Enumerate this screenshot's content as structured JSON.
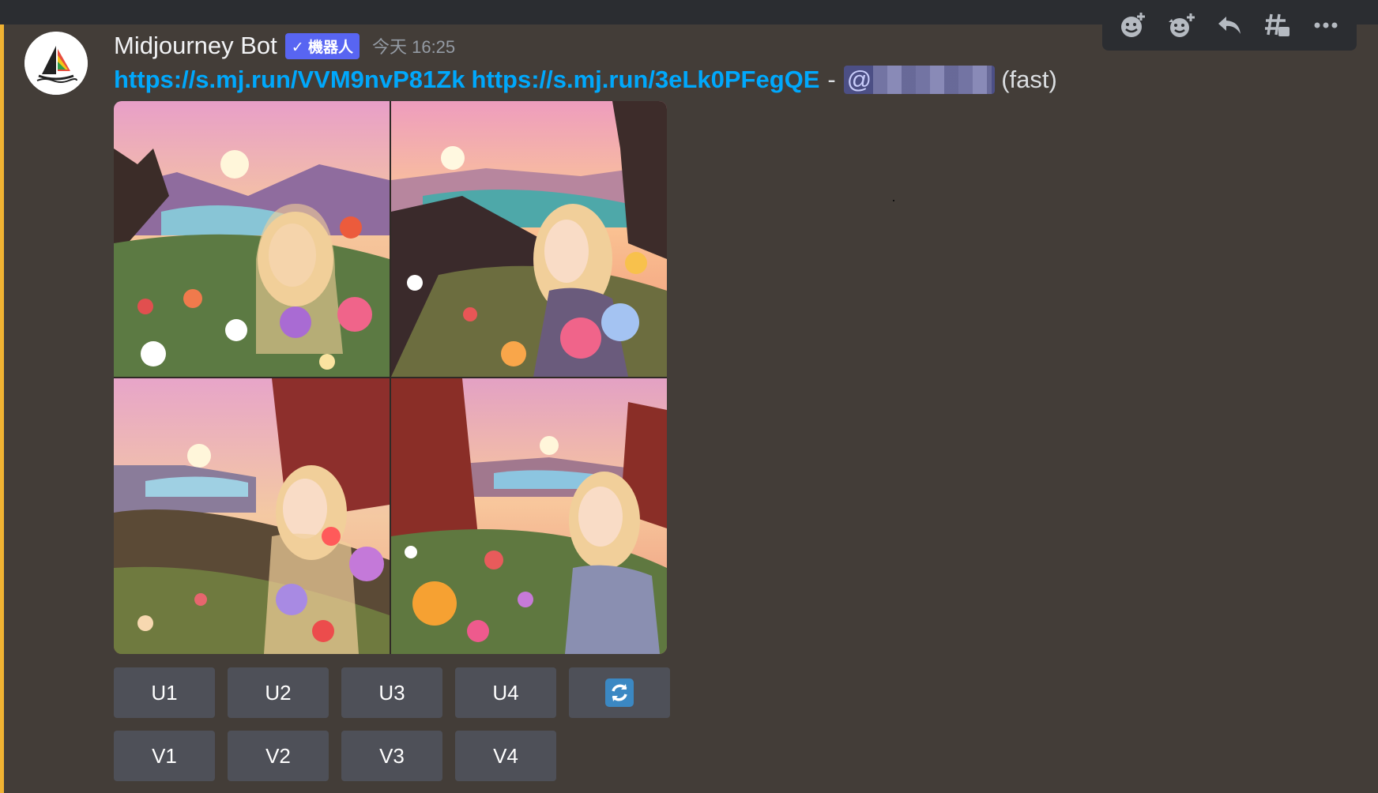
{
  "message": {
    "author": "Midjourney Bot",
    "badge": "✓ 機器人",
    "timestamp": "今天 16:25",
    "link1": "https://s.mj.run/VVM9nvP81Zk",
    "link2": "https://s.mj.run/3eLk0PFegQE",
    "separator": "-",
    "mention_prefix": "@",
    "suffix": "(fast)"
  },
  "image_grid": {
    "tiles": [
      "tile-1",
      "tile-2",
      "tile-3",
      "tile-4"
    ]
  },
  "buttons": {
    "upscale": [
      "U1",
      "U2",
      "U3",
      "U4"
    ],
    "variation": [
      "V1",
      "V2",
      "V3",
      "V4"
    ],
    "reroll_icon": "refresh-icon"
  },
  "toolbar": {
    "icons": [
      "add-reaction-icon",
      "add-super-reaction-icon",
      "reply-icon",
      "create-thread-icon",
      "more-icon"
    ]
  },
  "colors": {
    "background": "#433d38",
    "link": "#00a8fc",
    "badge": "#5865f2",
    "button": "#4e5058",
    "accent_bar": "#f0b232"
  }
}
